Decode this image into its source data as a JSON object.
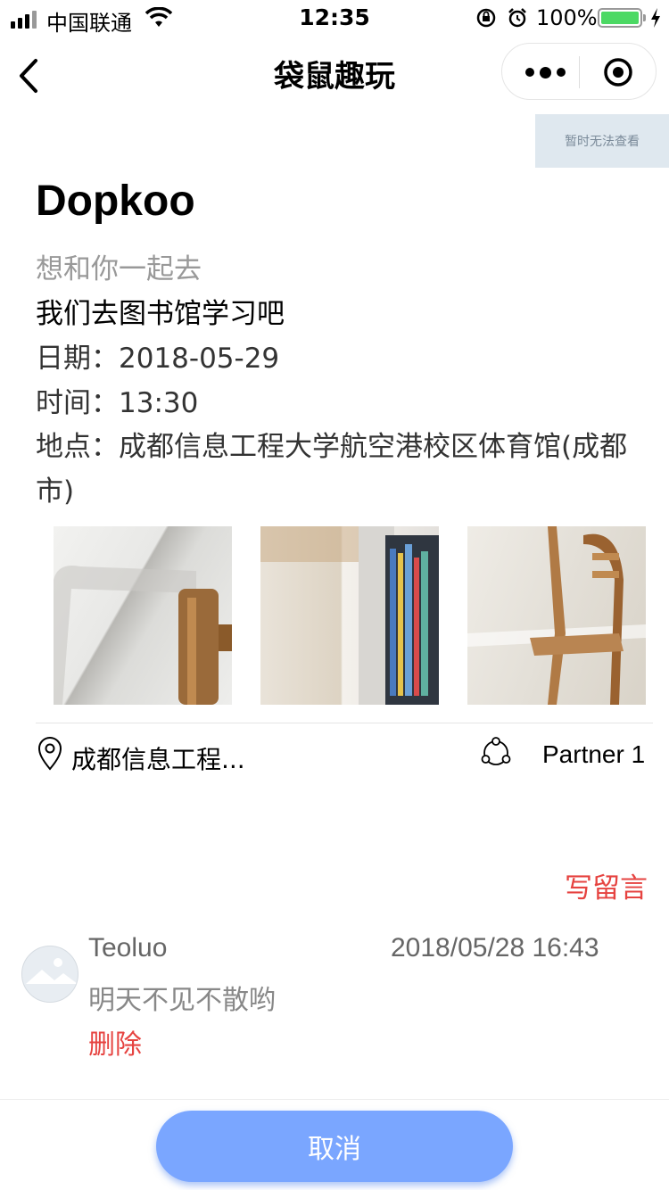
{
  "status_bar": {
    "carrier": "中国联通",
    "time": "12:35",
    "battery_pct": "100%"
  },
  "nav": {
    "title": "袋鼠趣玩"
  },
  "placeholder_text": "暂时无法查看",
  "event": {
    "title": "Dopkoo",
    "subtitle": "想和你一起去",
    "description": "我们去图书馆学习吧",
    "date_line": "日期：2018-05-29",
    "time_line": "时间：13:30",
    "place_line": "地点：成都信息工程大学航空港校区体育馆(成都市)"
  },
  "location_short": "成都信息工程...",
  "partner": "Partner 1",
  "write_comment": "写留言",
  "comment": {
    "name": "Teoluo",
    "time": "2018/05/28 16:43",
    "text": "明天不见不散哟",
    "delete": "删除"
  },
  "cancel": "取消",
  "colors": {
    "accent_red": "#e64340",
    "button_blue": "#7aa6ff"
  }
}
